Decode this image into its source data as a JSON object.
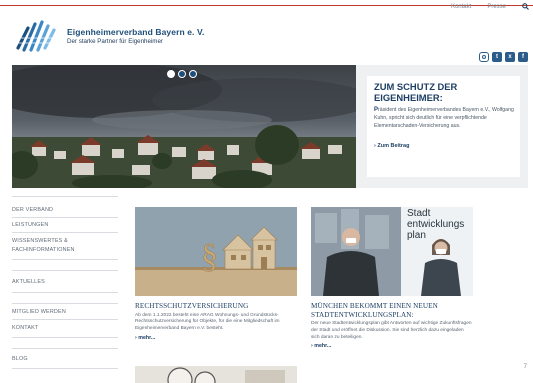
{
  "topnav": {
    "items": [
      "Kontakt",
      "Presse"
    ],
    "search_icon": "search-icon"
  },
  "brand": {
    "name": "Eigenheimerverband Bayern e. V.",
    "tagline": "Der starke Partner für Eigenheimer"
  },
  "social": [
    {
      "name": "instagram-icon",
      "glyph": "◎"
    },
    {
      "name": "twitter-icon",
      "glyph": "t"
    },
    {
      "name": "xing-icon",
      "glyph": "x"
    },
    {
      "name": "facebook-icon",
      "glyph": "f"
    }
  ],
  "slider": {
    "slides": 3,
    "active_index": 0
  },
  "teaser": {
    "title": "ZUM SCHUTZ DER EIGENHEIMER:",
    "initial": "P",
    "text": "räsident des Eigenheimerverbandes Bayern e.V., Wolfgang Kuhn, spricht sich deutlich für eine verpflichtende Elementarschaden-Versicherung aus.",
    "link": "› Zum Beitrag"
  },
  "sidebar": {
    "items": [
      "DER VERBAND",
      "LEISTUNGEN",
      "WISSENSWERTES &",
      "FACHINFORMATIONEN",
      "AKTUELLES",
      "MITGLIED WERDEN",
      "KONTAKT",
      "BLOG"
    ]
  },
  "cards": [
    {
      "title": "RECHTSSCHUTZVERSICHERUNG",
      "text": "Ab dem 1.1.2022 besteht eine ARAG Wohnungs- und Grundstücks-Rechtsschutzversicherung für Objekte, für die eine Mitgliedschaft im Eigenheimerverband Bayern e.V. besteht.",
      "more": "› mehr..."
    },
    {
      "title": "MÜNCHEN BEKOMMT EINEN NEUEN STADTENTWICKLUNGSPLAN:",
      "text": "Der neue Stadtentwicklungsplan gibt Antworten auf wichtige Zukunftsfragen der Stadt und eröffnet die Diskussion. Sie sind herzlich dazu eingeladen sich daran zu beteiligen.",
      "more": "› mehr...",
      "image_caption_line1": "Stadt",
      "image_caption_line2": "entwicklungs",
      "image_caption_line3": "plan"
    }
  ],
  "page_number": "7",
  "colors": {
    "brand": "#1d3f64",
    "accent_red": "#c0392b",
    "teaser_bg": "#eef0f2"
  }
}
